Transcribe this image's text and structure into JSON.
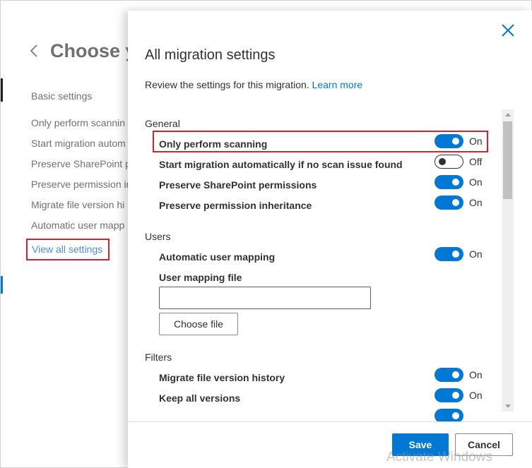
{
  "background": {
    "page_title": "Choose y",
    "heading": "Basic settings",
    "items": [
      "Only perform scannin",
      "Start migration autom",
      "Preserve SharePoint p",
      "Preserve permission in",
      "Migrate file version hi",
      "Automatic user mapp"
    ],
    "view_all_link": "View all settings"
  },
  "panel": {
    "title": "All migration settings",
    "description": "Review the settings for this migration.",
    "learn_more": "Learn more",
    "sections": {
      "general": {
        "label": "General",
        "settings": [
          {
            "label": "Only perform scanning",
            "state": "On"
          },
          {
            "label": "Start migration automatically if no scan issue found",
            "state": "Off"
          },
          {
            "label": "Preserve SharePoint permissions",
            "state": "On"
          },
          {
            "label": "Preserve permission inheritance",
            "state": "On"
          }
        ]
      },
      "users": {
        "label": "Users",
        "settings": [
          {
            "label": "Automatic user mapping",
            "state": "On"
          }
        ],
        "mapping_file_label": "User mapping file",
        "mapping_file_value": "",
        "choose_file_label": "Choose file"
      },
      "filters": {
        "label": "Filters",
        "settings": [
          {
            "label": "Migrate file version history",
            "state": "On"
          },
          {
            "label": "Keep all versions",
            "state": "On"
          }
        ]
      }
    },
    "footer": {
      "save_label": "Save",
      "cancel_label": "Cancel"
    }
  },
  "watermark": "Activate Windows",
  "colors": {
    "accent": "#0078d4",
    "highlight": "#d9202e"
  }
}
